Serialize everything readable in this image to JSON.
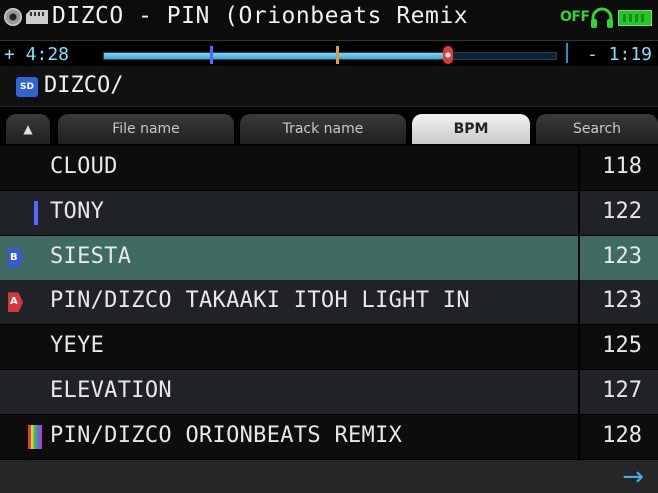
{
  "title_bar": {
    "title": "DIZCO - PIN (Orionbeats Remix",
    "output_status": "OFF",
    "icons": [
      "disc-icon",
      "memory-card-icon",
      "headphones-icon",
      "battery-icon"
    ]
  },
  "playback": {
    "elapsed": "+ 4:28",
    "remaining": "- 1:19",
    "progress": 0.76
  },
  "path_bar": {
    "path": "DIZCO/",
    "source_icon_label": "SD"
  },
  "tabs": {
    "sort_indicator": "▲",
    "items": [
      {
        "label": "File name",
        "active": false
      },
      {
        "label": "Track name",
        "active": false
      },
      {
        "label": "BPM",
        "active": true
      },
      {
        "label": "Search",
        "active": false
      }
    ]
  },
  "tracks": [
    {
      "name": "CLOUD",
      "bpm": "118",
      "marker": "none",
      "selected": false
    },
    {
      "name": "TONY",
      "bpm": "122",
      "marker": "blue-cue",
      "selected": false
    },
    {
      "name": "SIESTA",
      "bpm": "123",
      "marker": "deck-b",
      "deck_label": "B",
      "selected": true
    },
    {
      "name": "PIN/DIZCO TAKAAKI ITOH LIGHT IN",
      "bpm": "123",
      "marker": "deck-a",
      "deck_label": "A",
      "selected": false
    },
    {
      "name": "YEYE",
      "bpm": "125",
      "marker": "none",
      "selected": false
    },
    {
      "name": "ELEVATION",
      "bpm": "127",
      "marker": "none",
      "selected": false
    },
    {
      "name": "PIN/DIZCO ORIONBEATS REMIX",
      "bpm": "128",
      "marker": "rainbow",
      "selected": false
    }
  ],
  "footer": {
    "next_arrow": "→"
  },
  "colors": {
    "accent_blue": "#3fb2ea",
    "time_text": "#7fe0ff",
    "selected_row": "#3f6b63",
    "row_dark": "#0d0d0d",
    "row_light": "#1f2226",
    "status_green": "#35d235",
    "deck_a": "#d23a3a",
    "deck_b": "#3a5ad2",
    "cue_blue": "#5a66ff"
  }
}
